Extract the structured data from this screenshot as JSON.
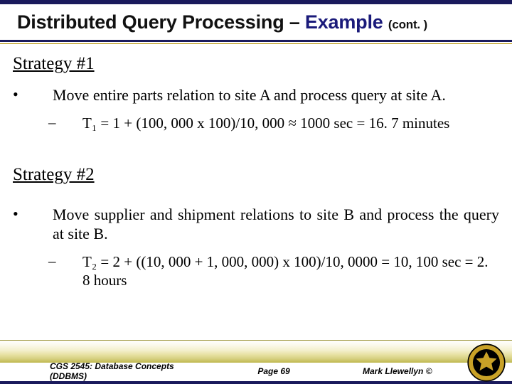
{
  "title": {
    "prefix": "Distributed Query Processing – ",
    "example": "Example ",
    "cont": "(cont. )"
  },
  "sections": {
    "s1": {
      "heading": "Strategy #1",
      "bullet_marker": "•",
      "bullet_text": "Move entire parts relation to site A and process query at site A.",
      "sub_marker": "–",
      "sub_text": "T₁ = 1 + (100, 000 x 100)/10, 000 ≈ 1000 sec = 16. 7 minutes"
    },
    "s2": {
      "heading": "Strategy #2",
      "bullet_marker": "•",
      "bullet_text": "Move supplier and shipment relations to site B and process the query at site B.",
      "sub_marker": "–",
      "sub_text": "T₂ = 2 + ((10, 000 + 1, 000, 000) x 100)/10, 0000 = 10, 100 sec = 2. 8 hours"
    }
  },
  "footer": {
    "course": "CGS 2545: Database Concepts  (DDBMS)",
    "page": "Page 69",
    "author": "Mark Llewellyn ©"
  }
}
